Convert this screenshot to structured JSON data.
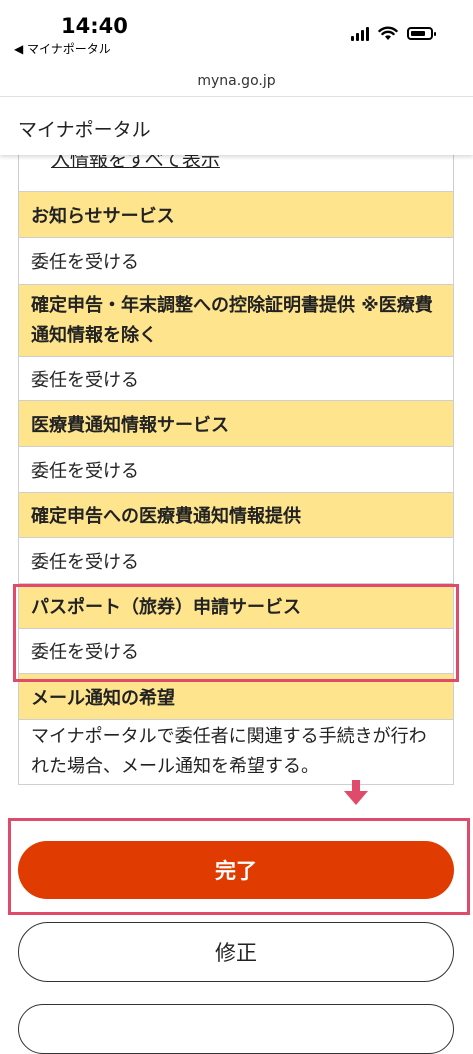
{
  "status_bar": {
    "time": "14:40",
    "back_app": "◀ マイナポータル"
  },
  "browser": {
    "url": "myna.go.jp"
  },
  "header": {
    "title": "マイナポータル"
  },
  "partial_link": "入情報をすべて表示",
  "sections": [
    {
      "title": "お知らせサービス",
      "value": "委任を受ける"
    },
    {
      "title": "確定申告・年末調整への控除証明書提供 ※医療費通知情報を除く",
      "value": "委任を受ける"
    },
    {
      "title": "医療費通知情報サービス",
      "value": "委任を受ける"
    },
    {
      "title": "確定申告への医療費通知情報提供",
      "value": "委任を受ける"
    },
    {
      "title": "パスポート（旅券）申請サービス",
      "value": "委任を受ける"
    },
    {
      "title": "メール通知の希望",
      "value": "マイナポータルで委任者に関連する手続きが行われた場合、メール通知を希望する。"
    }
  ],
  "buttons": {
    "complete": "完了",
    "edit": "修正"
  },
  "colors": {
    "section_header_bg": "#fde48d",
    "primary_button": "#e03b00",
    "highlight_border": "#e04a6b"
  }
}
